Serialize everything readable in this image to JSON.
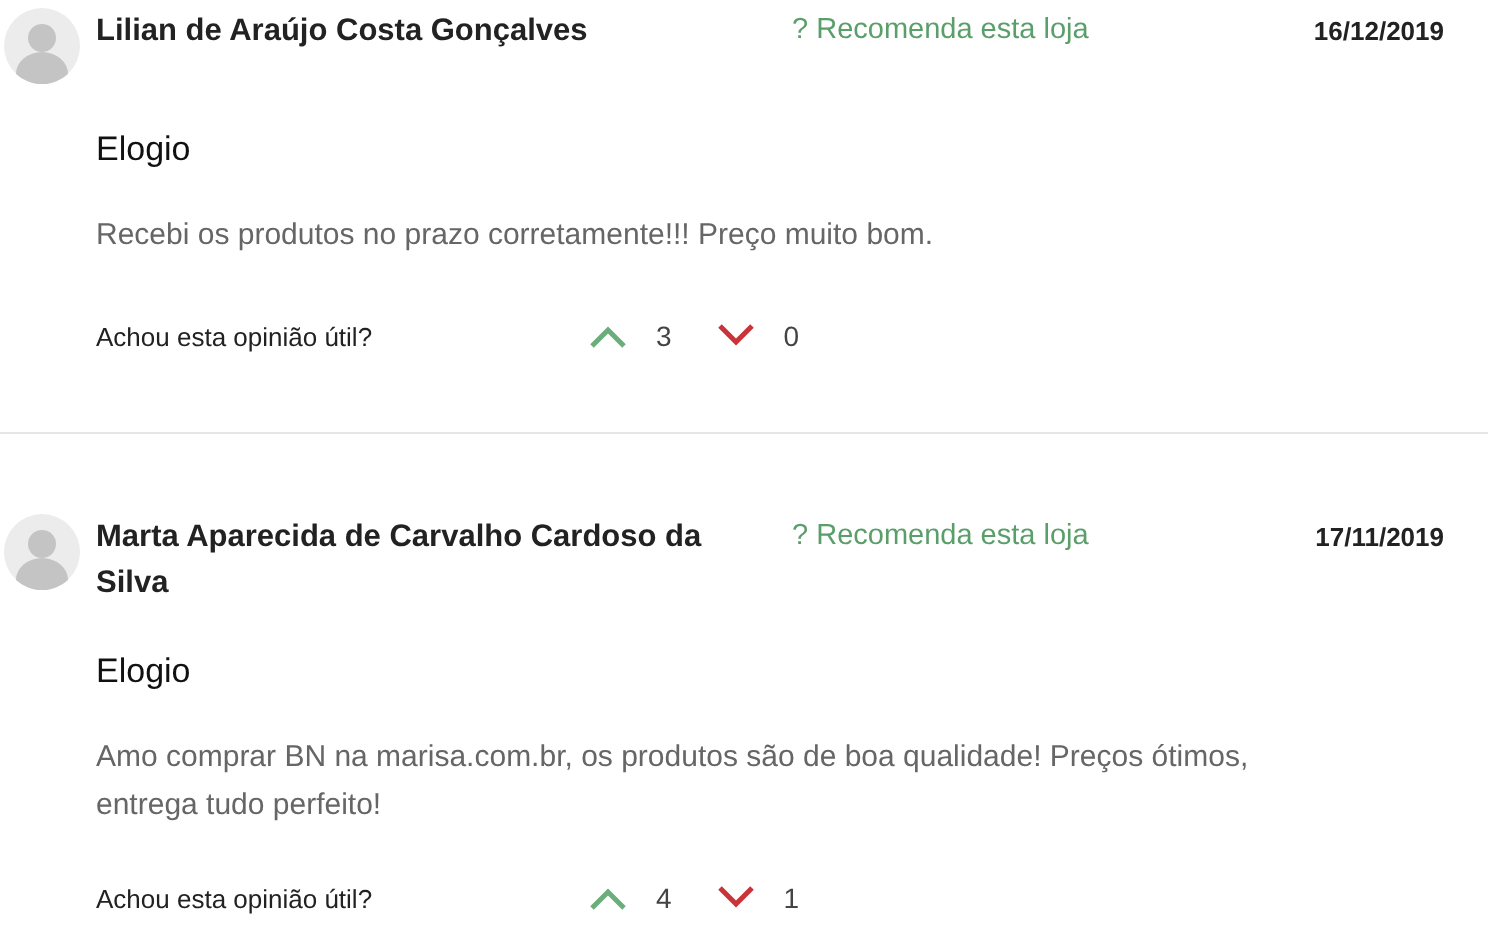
{
  "reviews": [
    {
      "author": "Lilian de Araújo Costa Gonçalves",
      "recommend": "? Recomenda esta loja",
      "date": "16/12/2019",
      "title": "Elogio",
      "body": "Recebi os produtos no prazo corretamente!!! Preço muito bom.",
      "helpful_label": "Achou esta opinião útil?",
      "upvotes": "3",
      "downvotes": "0"
    },
    {
      "author": "Marta Aparecida de Carvalho Cardoso da Silva",
      "recommend": "? Recomenda esta loja",
      "date": "17/11/2019",
      "title": "Elogio",
      "body": "Amo comprar BN na marisa.com.br, os produtos são de boa qualidade! Preços ótimos, entrega tudo perfeito!",
      "helpful_label": "Achou esta opinião útil?",
      "upvotes": "4",
      "downvotes": "1"
    }
  ]
}
